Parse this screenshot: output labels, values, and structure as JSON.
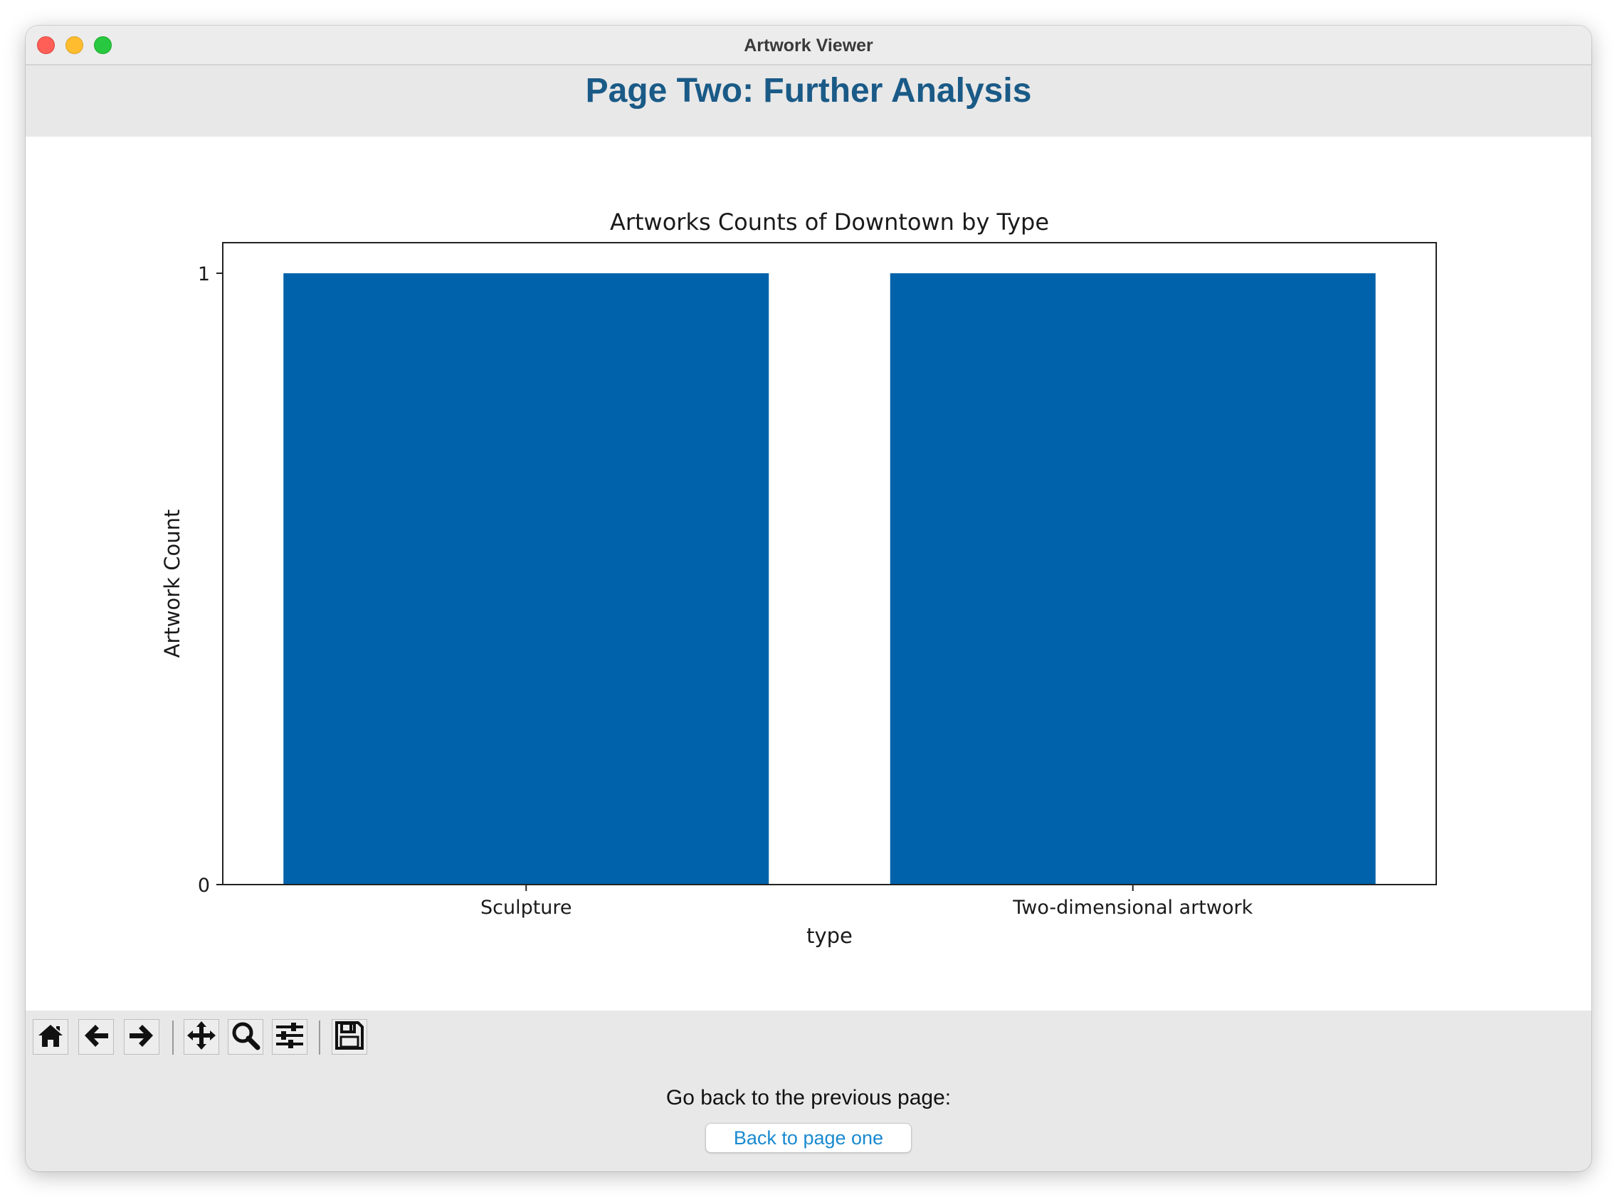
{
  "window": {
    "title": "Artwork Viewer"
  },
  "page": {
    "heading": "Page Two: Further Analysis"
  },
  "chart_data": {
    "type": "bar",
    "title": "Artworks Counts of Downtown by Type",
    "xlabel": "type",
    "ylabel": "Artwork Count",
    "categories": [
      "Sculpture",
      "Two-dimensional artwork"
    ],
    "values": [
      1,
      1
    ],
    "yticks": [
      "0",
      "1"
    ],
    "ylim": [
      0,
      1.05
    ],
    "bar_color": "#0062ab",
    "grid": false
  },
  "toolbar": {
    "buttons": [
      {
        "icon": "home-icon",
        "tooltip": "Home"
      },
      {
        "icon": "arrow-left-icon",
        "tooltip": "Back"
      },
      {
        "icon": "arrow-right-icon",
        "tooltip": "Forward"
      },
      {
        "icon": "pan-icon",
        "tooltip": "Pan"
      },
      {
        "icon": "zoom-icon",
        "tooltip": "Zoom"
      },
      {
        "icon": "sliders-icon",
        "tooltip": "Configure subplots"
      },
      {
        "icon": "save-icon",
        "tooltip": "Save"
      }
    ]
  },
  "footer": {
    "prompt": "Go back to the previous page:",
    "back_button_label": "Back to page one",
    "link_color": "#1a8ad0"
  }
}
